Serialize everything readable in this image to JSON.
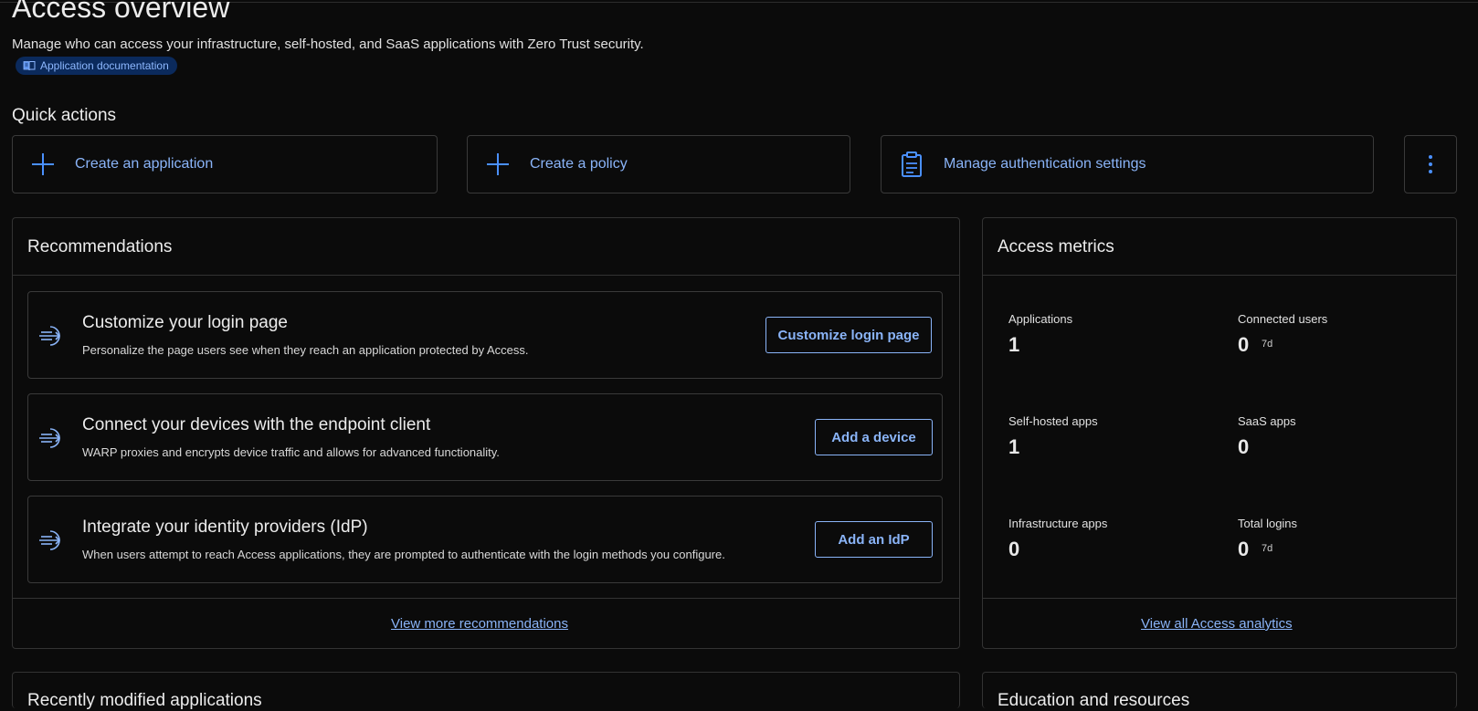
{
  "header": {
    "title": "Access overview",
    "subtitle": "Manage who can access your infrastructure, self-hosted, and SaaS applications with Zero Trust security.",
    "doc_link": "Application documentation"
  },
  "quick_actions": {
    "heading": "Quick actions",
    "items": [
      {
        "label": "Create an application",
        "icon": "plus-icon"
      },
      {
        "label": "Create a policy",
        "icon": "plus-icon"
      },
      {
        "label": "Manage authentication settings",
        "icon": "clipboard-icon"
      }
    ],
    "more_icon": "more-vertical-icon"
  },
  "recommendations": {
    "title": "Recommendations",
    "items": [
      {
        "title": "Customize your login page",
        "description": "Personalize the page users see when they reach an application protected by Access.",
        "button": "Customize login page"
      },
      {
        "title": "Connect your devices with the endpoint client",
        "description": "WARP proxies and encrypts device traffic and allows for advanced functionality.",
        "button": "Add a device"
      },
      {
        "title": "Integrate your identity providers (IdP)",
        "description": "When users attempt to reach Access applications, they are prompted to authenticate with the login methods you configure.",
        "button": "Add an IdP"
      }
    ],
    "footer_link": "View more recommendations"
  },
  "metrics": {
    "title": "Access metrics",
    "items": [
      {
        "label": "Applications",
        "value": "1",
        "sub": ""
      },
      {
        "label": "Connected users",
        "value": "0",
        "sub": "7d"
      },
      {
        "label": "Self-hosted apps",
        "value": "1",
        "sub": ""
      },
      {
        "label": "SaaS apps",
        "value": "0",
        "sub": ""
      },
      {
        "label": "Infrastructure apps",
        "value": "0",
        "sub": ""
      },
      {
        "label": "Total logins",
        "value": "0",
        "sub": "7d"
      }
    ],
    "footer_link": "View all Access analytics"
  },
  "bottom": {
    "left_title": "Recently modified applications",
    "right_title": "Education and resources"
  },
  "colors": {
    "accent": "#8ab4f8",
    "icon_blue": "#4a90ff",
    "background": "#0b0b0b",
    "border": "#333333"
  }
}
